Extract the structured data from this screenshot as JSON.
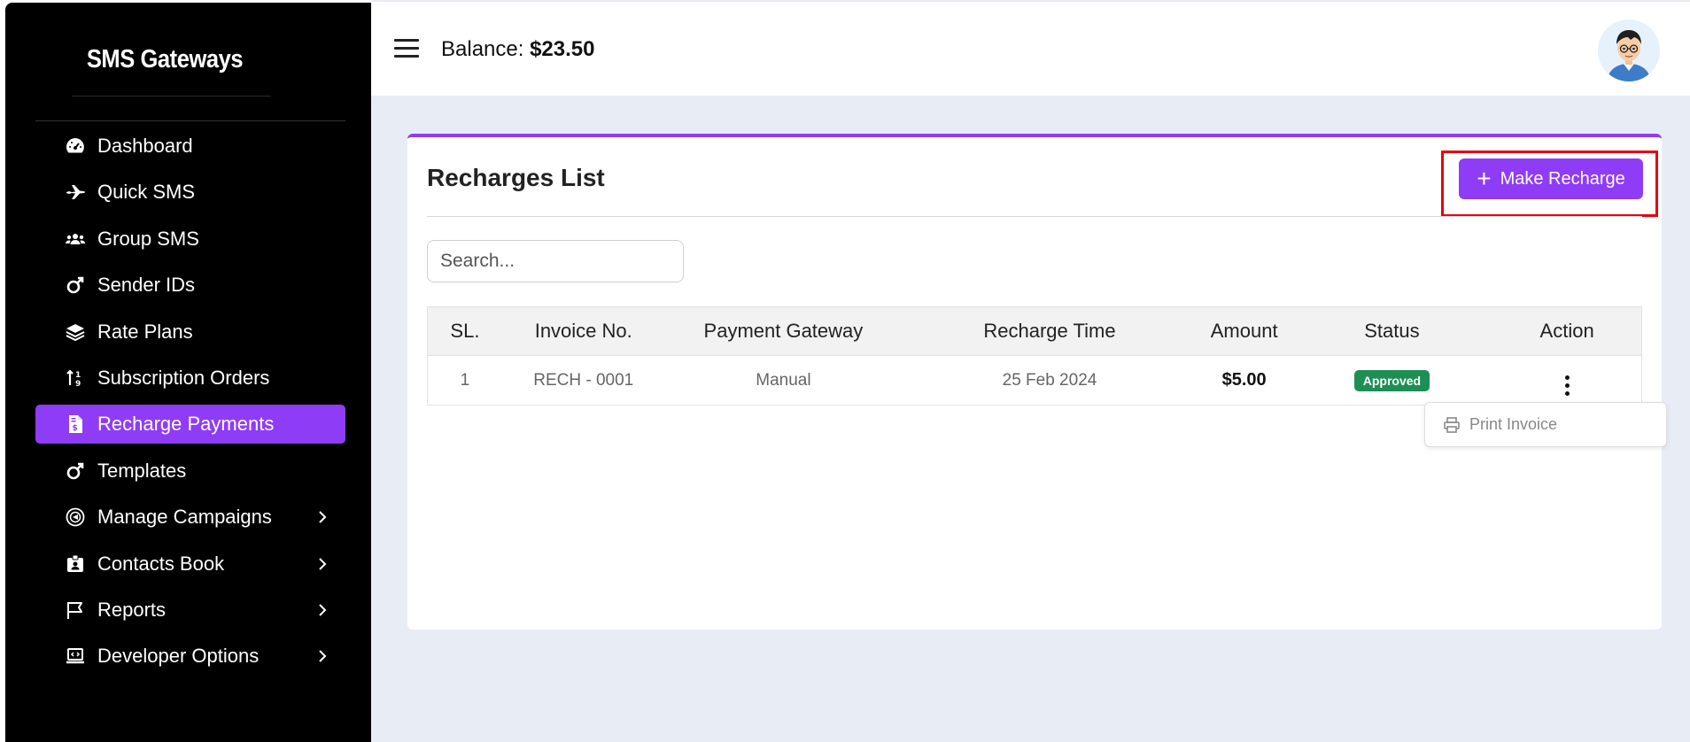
{
  "sidebar": {
    "brand": "SMS Gateways",
    "items": [
      {
        "label": "Dashboard",
        "icon": "gauge-icon"
      },
      {
        "label": "Quick SMS",
        "icon": "plane-icon"
      },
      {
        "label": "Group SMS",
        "icon": "users-icon"
      },
      {
        "label": "Sender IDs",
        "icon": "mars-icon"
      },
      {
        "label": "Rate Plans",
        "icon": "layers-icon"
      },
      {
        "label": "Subscription Orders",
        "icon": "sort-icon"
      },
      {
        "label": "Recharge Payments",
        "icon": "invoice-dollar-icon",
        "active": true
      },
      {
        "label": "Templates",
        "icon": "mars-icon"
      },
      {
        "label": "Manage Campaigns",
        "icon": "campaign-icon",
        "submenu": true
      },
      {
        "label": "Contacts Book",
        "icon": "id-badge-icon",
        "submenu": true
      },
      {
        "label": "Reports",
        "icon": "flag-icon",
        "submenu": true
      },
      {
        "label": "Developer Options",
        "icon": "laptop-code-icon",
        "submenu": true
      }
    ]
  },
  "topbar": {
    "balance_label": "Balance:",
    "balance_value": "$23.50"
  },
  "card": {
    "title": "Recharges List",
    "make_recharge_label": "Make Recharge",
    "search_placeholder": "Search..."
  },
  "table": {
    "columns": [
      "SL.",
      "Invoice No.",
      "Payment Gateway",
      "Recharge Time",
      "Amount",
      "Status",
      "Action"
    ],
    "rows": [
      {
        "sl": "1",
        "invoice": "RECH - 0001",
        "gateway": "Manual",
        "time": "25 Feb 2024",
        "amount": "$5.00",
        "status": "Approved"
      }
    ]
  },
  "dropdown": {
    "print_invoice_label": "Print Invoice"
  },
  "colors": {
    "accent": "#8f3cf7",
    "approved": "#1d8f55",
    "highlight": "#e6000f"
  }
}
